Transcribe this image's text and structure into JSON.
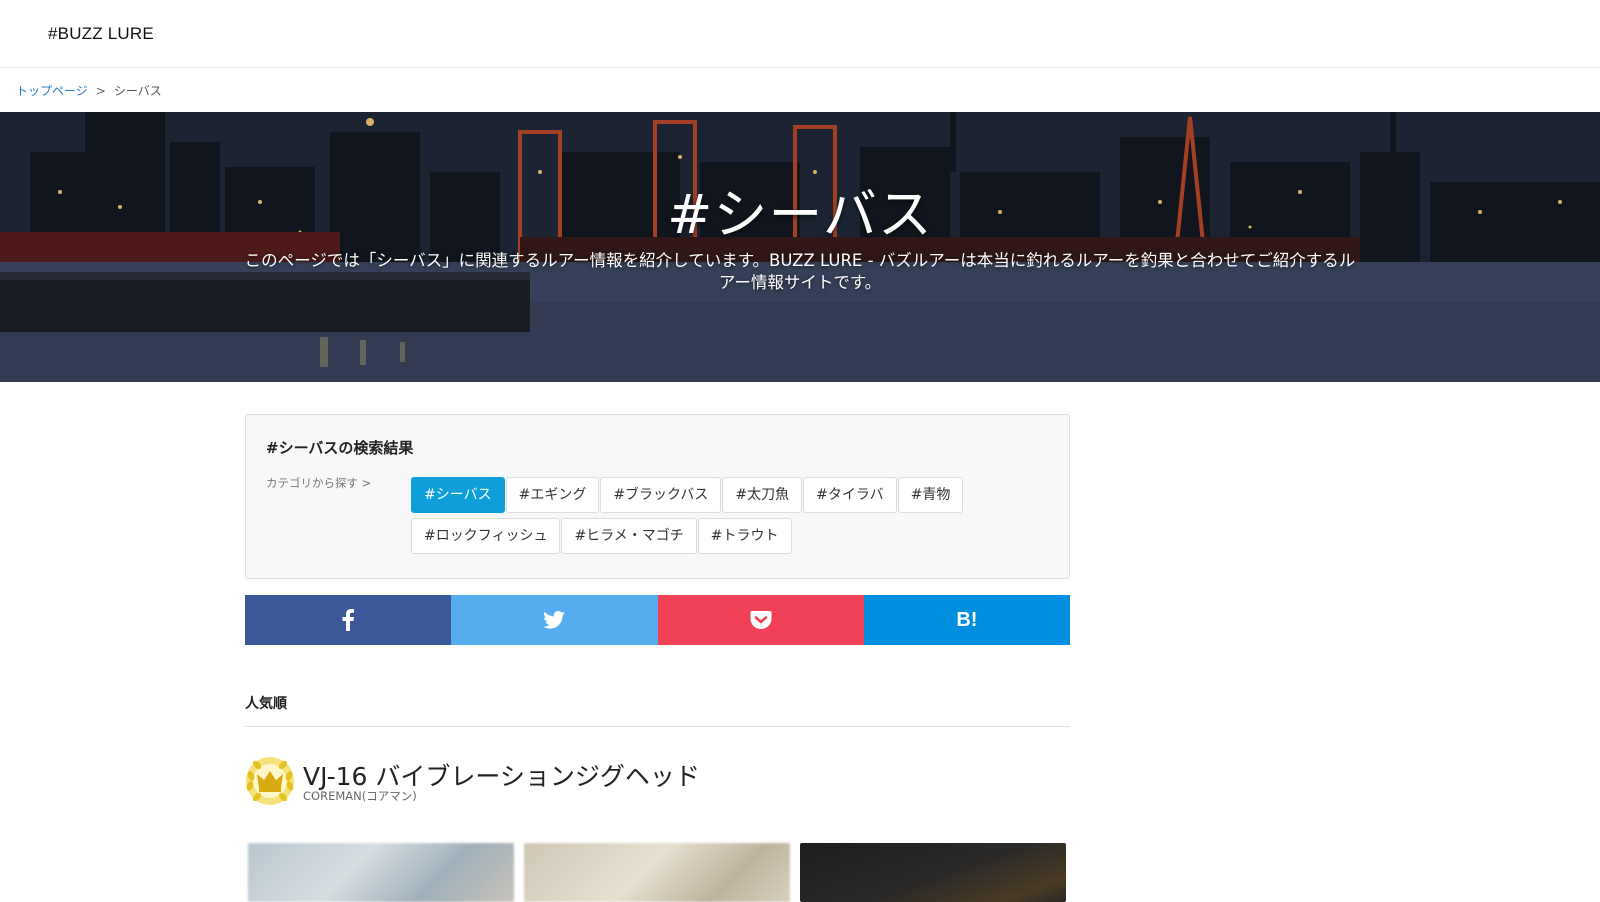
{
  "site": {
    "logo": "#BUZZ LURE"
  },
  "breadcrumb": {
    "home": "トップページ",
    "separator": ">",
    "current": "シーバス"
  },
  "hero": {
    "title": "#シーバス",
    "description": "このページでは「シーバス」に関連するルアー情報を紹介しています。BUZZ LURE - バズルアーは本当に釣れるルアーを釣果と合わせてご紹介するルアー情報サイトです。"
  },
  "search": {
    "title": "#シーバスの検索結果",
    "category_label": "カテゴリから探す >",
    "tags": [
      {
        "label": "#シーバス",
        "active": true
      },
      {
        "label": "#エギング",
        "active": false
      },
      {
        "label": "#ブラックバス",
        "active": false
      },
      {
        "label": "#太刀魚",
        "active": false
      },
      {
        "label": "#タイラバ",
        "active": false
      },
      {
        "label": "#青物",
        "active": false
      },
      {
        "label": "#ロックフィッシュ",
        "active": false
      },
      {
        "label": "#ヒラメ・マゴチ",
        "active": false
      },
      {
        "label": "#トラウト",
        "active": false
      }
    ]
  },
  "share": {
    "facebook_color": "#3b5998",
    "twitter_color": "#55acee",
    "pocket_color": "#ef4056",
    "hatena_color": "#008fde",
    "hatena_label": "B!"
  },
  "ranking": {
    "sort_label": "人気順",
    "items": [
      {
        "rank_icon": "gold-crown-icon",
        "name": "VJ-16 バイブレーションジグヘッド",
        "maker": "COREMAN(コアマン)"
      }
    ]
  },
  "colors": {
    "accent": "#0e9ed9",
    "link": "#2a7bc4",
    "gold": "#e4c21f"
  }
}
